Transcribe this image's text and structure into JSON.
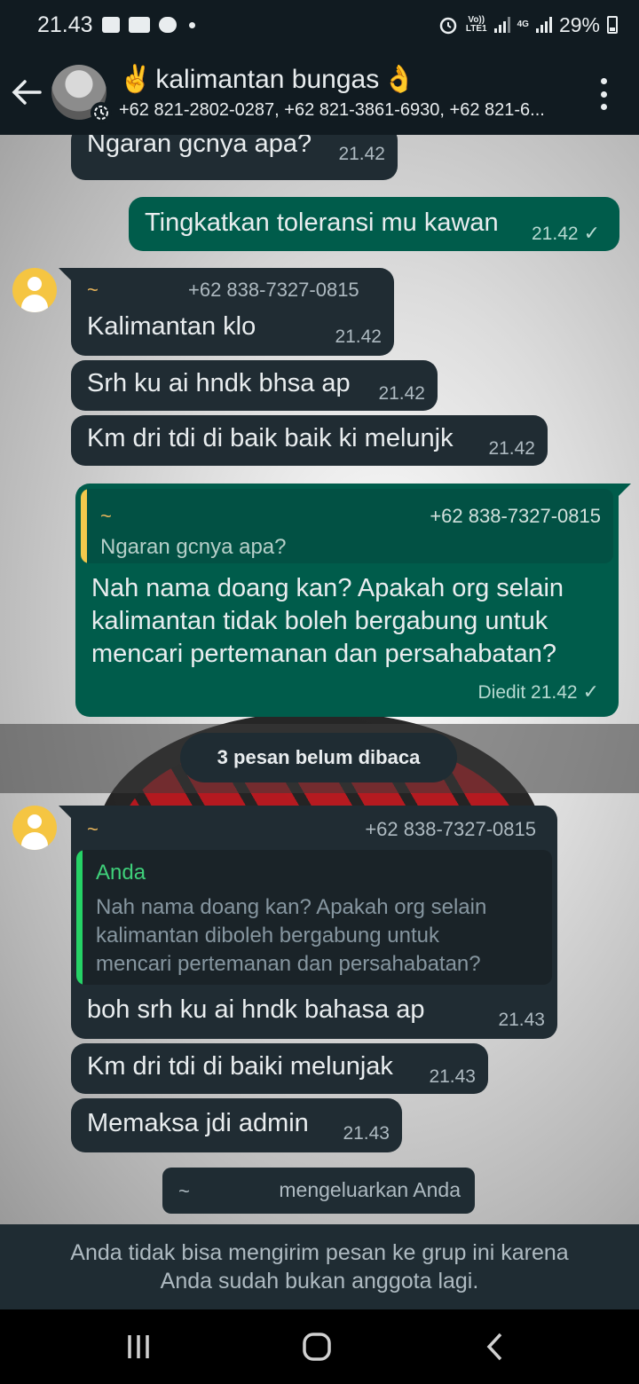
{
  "status_bar": {
    "time": "21.43",
    "volte_label": "Vo))",
    "lte_label": "LTE1",
    "network_label": "4G",
    "battery": "29%"
  },
  "header": {
    "emoji_left": "✌️",
    "title": "kalimantan bungas",
    "emoji_right": "👌",
    "members": "+62 821-2802-0287, +62 821-3861-6930, +62 821-6..."
  },
  "messages": [
    {
      "text": "Ngaran gcnya apa?",
      "time": "21.42"
    },
    {
      "text": "Tingkatkan toleransi mu kawan",
      "time": "21.42"
    },
    {
      "sender_name": "~",
      "sender_phone": "+62 838-7327-0815",
      "text": "Kalimantan klo",
      "time": "21.42"
    },
    {
      "text": "Srh ku ai hndk bhsa ap",
      "time": "21.42"
    },
    {
      "text": "Km dri tdi di baik baik ki melunjk",
      "time": "21.42"
    },
    {
      "quote_name": "~",
      "quote_phone": "+62 838-7327-0815",
      "quote_text": "Ngaran gcnya apa?",
      "text_lines": [
        "Nah nama doang kan? Apakah org selain",
        "kalimantan tidak boleh bergabung untuk",
        "mencari pertemanan  dan persahabatan?"
      ],
      "edited_time": "Diedit 21.42"
    },
    {
      "sender_name": "~",
      "sender_phone": "+62 838-7327-0815",
      "quote_name": "Anda",
      "quote_lines": [
        "Nah nama doang kan? Apakah org selain",
        "kalimantan diboleh bergabung untuk",
        "mencari pertemanan  dan persahabatan?"
      ],
      "text": "boh srh ku ai hndk bahasa ap",
      "time": "21.43"
    },
    {
      "text": "Km dri tdi di baiki melunjak",
      "time": "21.43"
    },
    {
      "text": "Memaksa jdi admin",
      "time": "21.43"
    }
  ],
  "unread_divider": "3 pesan belum dibaca",
  "system_message": {
    "actor": "~",
    "text": "mengeluarkan Anda"
  },
  "footer": {
    "line1": "Anda tidak bisa mengirim pesan ke grup ini karena",
    "line2": "Anda sudah bukan anggota lagi."
  },
  "colors": {
    "header_bg": "#111b21",
    "incoming_bubble": "#202c33",
    "outgoing_bubble": "#005c4b",
    "quote_bar_yellow": "#f2c94c",
    "quote_bar_green": "#25d366",
    "avatar_yellow": "#f5c542"
  },
  "icons": {
    "back": "arrow-left-icon",
    "menu": "more-vertical-icon",
    "timer": "disappearing-timer-icon",
    "tick": "check-icon",
    "nav_recents": "recents-icon",
    "nav_home": "home-icon",
    "nav_back": "nav-back-icon"
  }
}
